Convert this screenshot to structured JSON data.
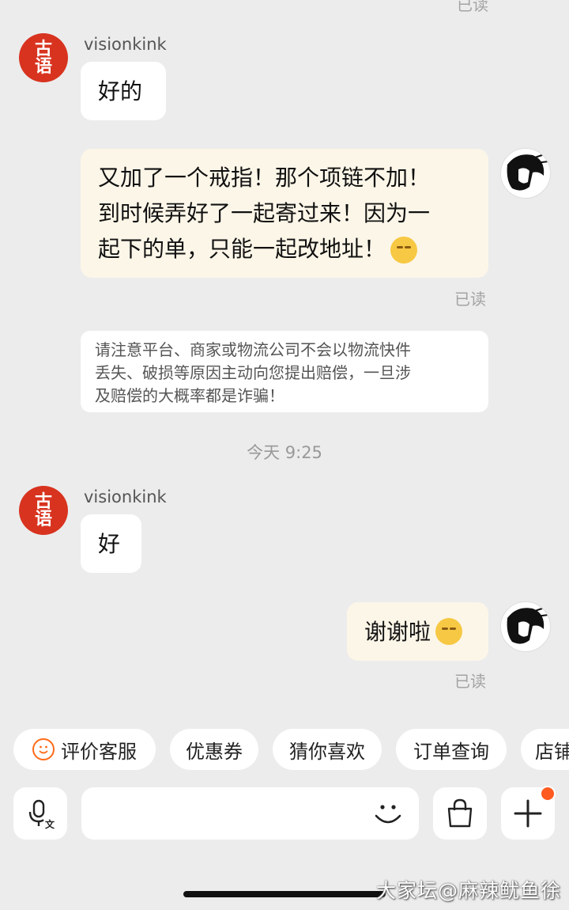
{
  "top_read_label": "已读",
  "messages": [
    {
      "sender": "visionkink",
      "text": "好的"
    },
    {
      "text_lines": [
        "又加了一个戒指！那个项链不加！",
        "到时候弄好了一起寄过来！因为一",
        "起下的单，只能一起改地址！"
      ],
      "read": "已读"
    },
    {
      "sender": "visionkink",
      "text": "好"
    },
    {
      "text": "谢谢啦",
      "read": "已读"
    }
  ],
  "seal_avatar_text": "古语",
  "notice_lines": [
    "请注意平台、商家或物流公司不会以物流快件",
    "丢失、破损等原因主动向您提出赔偿，一旦涉",
    "及赔偿的大概率都是诈骗！"
  ],
  "timestamp": "今天 9:25",
  "chips": [
    "评价客服",
    "优惠券",
    "猜你喜欢",
    "订单查询",
    "店铺"
  ],
  "icons": {
    "voice": "mic-translate-icon",
    "emoji": "smile-face-icon",
    "bag": "shopping-bag-icon",
    "plus": "plus-icon",
    "chip_smile": "smile-icon"
  },
  "colors": {
    "accent": "#ff5a1f",
    "seal": "#d8331f",
    "outgoing_bubble": "#fcf6e8"
  },
  "watermark": "大家坛@麻辣鱿鱼徐"
}
